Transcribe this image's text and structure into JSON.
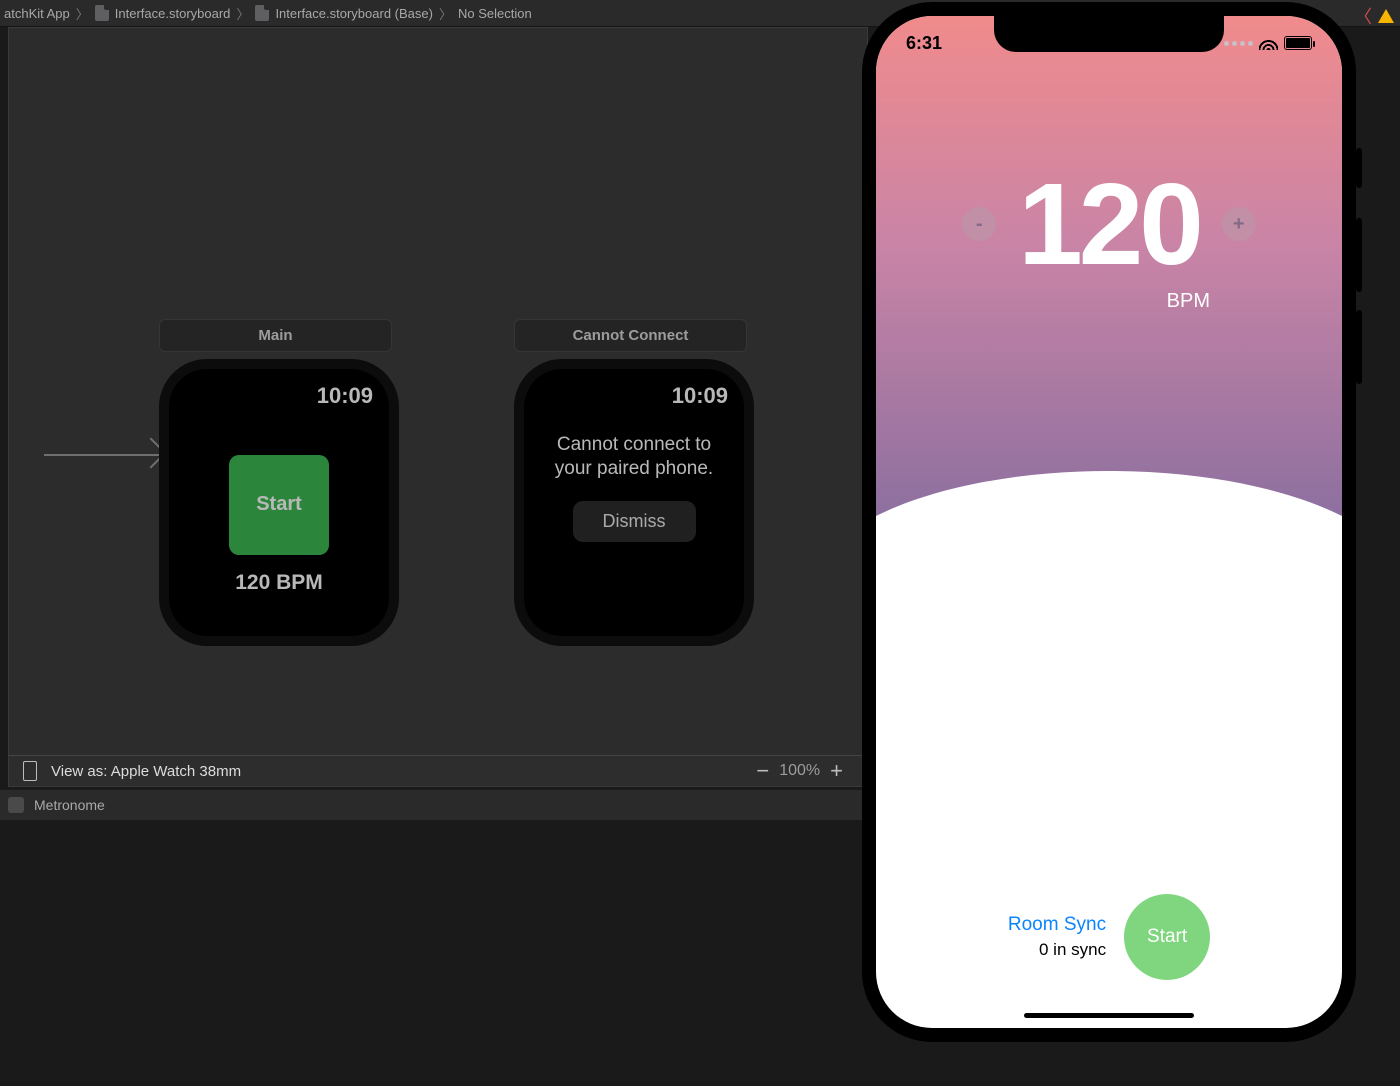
{
  "breadcrumb": {
    "items": [
      "atchKit App",
      "Interface.storyboard",
      "Interface.storyboard (Base)",
      "No Selection"
    ]
  },
  "canvas": {
    "scenes": {
      "main": {
        "label": "Main",
        "time": "10:09",
        "start_label": "Start",
        "bpm_line": "120 BPM"
      },
      "error": {
        "label": "Cannot Connect",
        "time": "10:09",
        "message": "Cannot connect to your paired phone.",
        "dismiss_label": "Dismiss"
      }
    },
    "toolbar": {
      "view_as": "View as: Apple Watch 38mm",
      "zoom": "100%"
    }
  },
  "console": {
    "label": "Metronome"
  },
  "phone": {
    "status_time": "6:31",
    "bpm_value": "120",
    "bpm_unit": "BPM",
    "minus": "-",
    "plus": "+",
    "room_sync": "Room Sync",
    "sync_status": "0 in sync",
    "start_label": "Start"
  }
}
